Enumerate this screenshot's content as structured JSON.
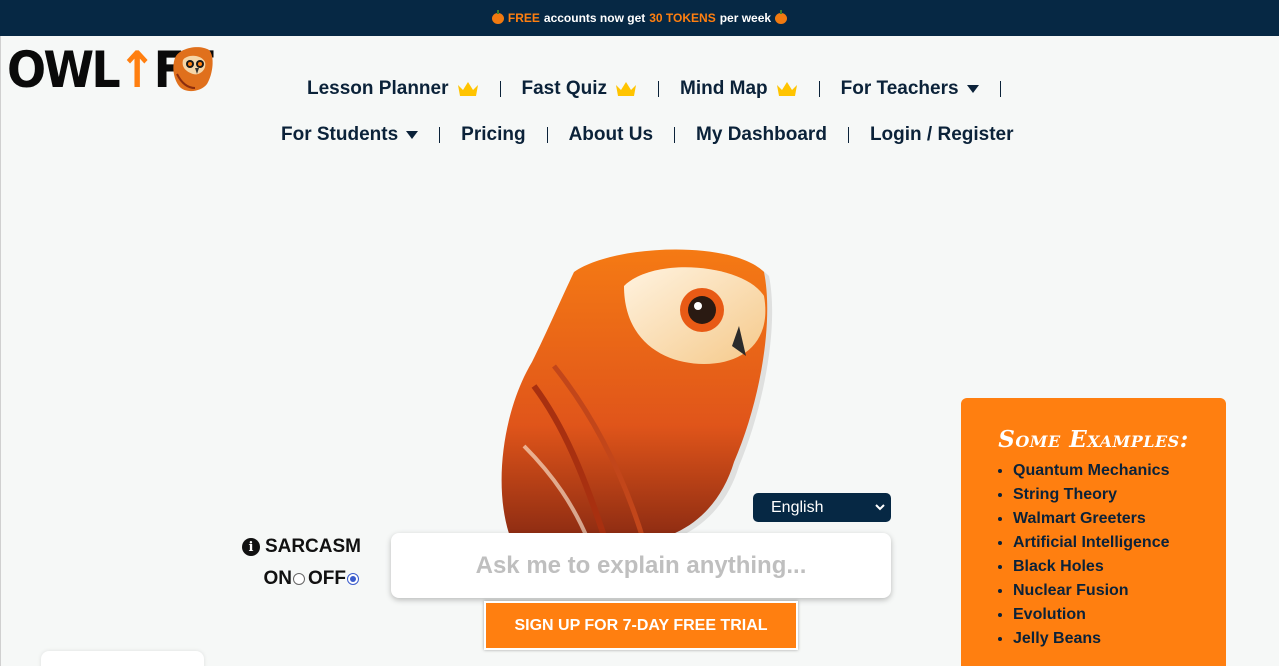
{
  "promo": {
    "icon": "pumpkin-icon",
    "free": "FREE",
    "mid": "accounts now get",
    "tokens": "30 TOKENS",
    "end": "per week"
  },
  "logo": {
    "text_a": "OWL",
    "text_b": "FT",
    "alt_icon": "owl-icon"
  },
  "nav": {
    "row1": [
      {
        "label": "Lesson Planner",
        "icon": "crown-icon"
      },
      {
        "label": "Fast Quiz",
        "icon": "crown-icon"
      },
      {
        "label": "Mind Map",
        "icon": "crown-icon"
      },
      {
        "label": "For Teachers",
        "icon": "caret-down-icon"
      }
    ],
    "row2": [
      {
        "label": "For Students",
        "icon": "caret-down-icon"
      },
      {
        "label": "Pricing"
      },
      {
        "label": "About Us"
      },
      {
        "label": "My Dashboard"
      },
      {
        "label": "Login / Register"
      }
    ]
  },
  "language": {
    "selected": "English"
  },
  "sarcasm": {
    "label": "SARCASM",
    "on": "ON",
    "off": "OFF",
    "value": "OFF"
  },
  "ask": {
    "placeholder": "Ask me to explain anything..."
  },
  "signup": {
    "label": "SIGN UP FOR 7-DAY FREE TRIAL"
  },
  "examples": {
    "title": "Some Examples:",
    "items": [
      "Quantum Mechanics",
      "String Theory",
      "Walmart Greeters",
      "Artificial Intelligence",
      "Black Holes",
      "Nuclear Fusion",
      "Evolution",
      "Jelly Beans"
    ]
  },
  "colors": {
    "navy": "#062844",
    "orange": "#ff7f10",
    "background": "#f6f8f7"
  }
}
